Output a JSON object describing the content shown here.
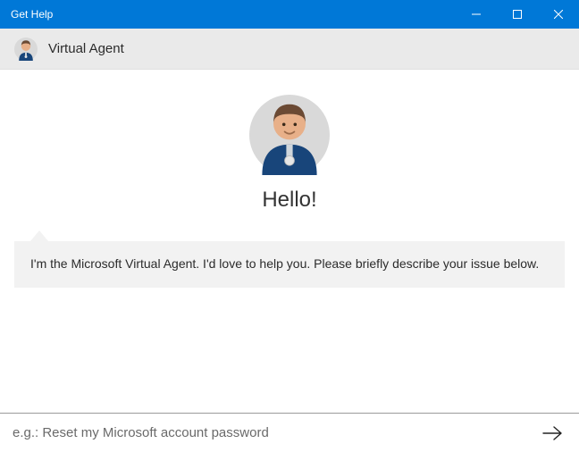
{
  "window": {
    "title": "Get Help"
  },
  "header": {
    "title": "Virtual Agent"
  },
  "chat": {
    "greeting": "Hello!",
    "intro_message": "I'm the Microsoft Virtual Agent. I'd love to help you. Please briefly describe your issue below."
  },
  "input": {
    "placeholder": "e.g.: Reset my Microsoft account password",
    "value": ""
  }
}
